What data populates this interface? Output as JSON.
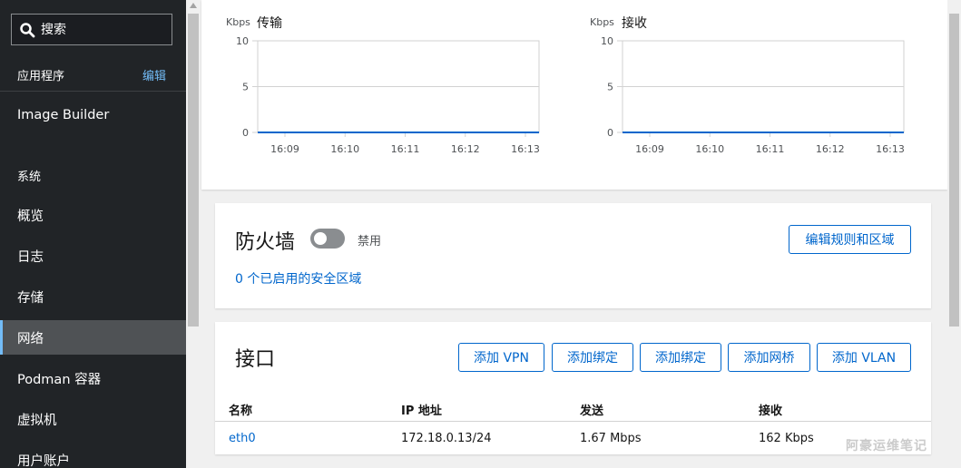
{
  "sidebar": {
    "search_placeholder": "搜索",
    "apps_header": "应用程序",
    "apps_edit": "编辑",
    "apps_items": [
      "Image Builder"
    ],
    "system_header": "系统",
    "system_items": [
      "概览",
      "日志",
      "存储",
      "网络",
      "Podman 容器",
      "虚拟机",
      "用户账户"
    ],
    "active_item": "网络"
  },
  "charts": [
    {
      "chart_data": {
        "type": "line",
        "title": "传输",
        "ylabel": "Kbps",
        "ylim": [
          0,
          10
        ],
        "yticks": [
          0,
          5,
          10
        ],
        "x": [
          "16:09",
          "16:10",
          "16:11",
          "16:12",
          "16:13"
        ],
        "series": [
          {
            "values": [
              0,
              0,
              0,
              0,
              0
            ]
          }
        ],
        "grid": true
      }
    },
    {
      "chart_data": {
        "type": "line",
        "title": "接收",
        "ylabel": "Kbps",
        "ylim": [
          0,
          10
        ],
        "yticks": [
          0,
          5,
          10
        ],
        "x": [
          "16:09",
          "16:10",
          "16:11",
          "16:12",
          "16:13"
        ],
        "series": [
          {
            "values": [
              0,
              0,
              0,
              0,
              0
            ]
          }
        ],
        "grid": true
      }
    }
  ],
  "firewall": {
    "title": "防火墙",
    "toggle_label": "禁用",
    "toggle_on": false,
    "zones_link": "0 个已启用的安全区域",
    "edit_button": "编辑规则和区域"
  },
  "interfaces": {
    "title": "接口",
    "buttons": [
      "添加 VPN",
      "添加绑定",
      "添加绑定",
      "添加网桥",
      "添加 VLAN"
    ],
    "columns": [
      "名称",
      "IP 地址",
      "发送",
      "接收"
    ],
    "rows": [
      {
        "name": "eth0",
        "ip": "172.18.0.13/24",
        "send": "1.67 Mbps",
        "receive": "162 Kbps"
      }
    ]
  },
  "watermark": "阿豪运维笔记",
  "colors": {
    "accent": "#0066cc",
    "sidebar_bg": "#212427",
    "link_light": "#73bcf7",
    "chart_line": "#0066cc"
  }
}
